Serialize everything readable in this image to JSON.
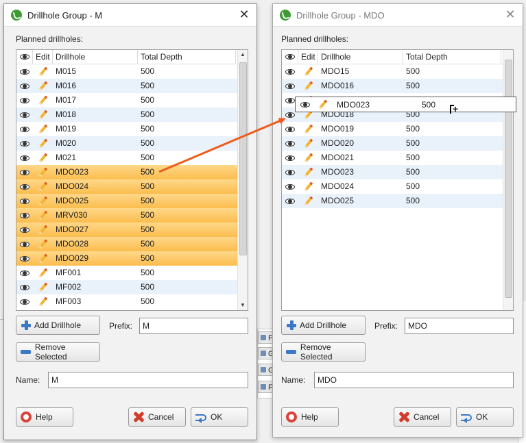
{
  "left_dialog": {
    "title": "Drillhole Group - M",
    "section_label": "Planned drillholes:",
    "columns": [
      "Edit",
      "Drillhole",
      "Total Depth"
    ],
    "rows": [
      {
        "name": "M015",
        "depth": "500",
        "selected": false
      },
      {
        "name": "M016",
        "depth": "500",
        "selected": false
      },
      {
        "name": "M017",
        "depth": "500",
        "selected": false
      },
      {
        "name": "M018",
        "depth": "500",
        "selected": false
      },
      {
        "name": "M019",
        "depth": "500",
        "selected": false
      },
      {
        "name": "M020",
        "depth": "500",
        "selected": false
      },
      {
        "name": "M021",
        "depth": "500",
        "selected": false
      },
      {
        "name": "MDO023",
        "depth": "500",
        "selected": true
      },
      {
        "name": "MDO024",
        "depth": "500",
        "selected": true
      },
      {
        "name": "MDO025",
        "depth": "500",
        "selected": true
      },
      {
        "name": "MRV030",
        "depth": "500",
        "selected": true
      },
      {
        "name": "MDO027",
        "depth": "500",
        "selected": true
      },
      {
        "name": "MDO028",
        "depth": "500",
        "selected": true
      },
      {
        "name": "MDO029",
        "depth": "500",
        "selected": true
      },
      {
        "name": "MF001",
        "depth": "500",
        "selected": false
      },
      {
        "name": "MF002",
        "depth": "500",
        "selected": false
      },
      {
        "name": "MF003",
        "depth": "500",
        "selected": false
      }
    ],
    "add_label": "Add Drillhole",
    "prefix_label": "Prefix:",
    "prefix_value": "M",
    "remove_label": "Remove Selected",
    "name_label": "Name:",
    "name_value": "M",
    "help_label": "Help",
    "cancel_label": "Cancel",
    "ok_label": "OK"
  },
  "right_dialog": {
    "title": "Drillhole Group - MDO",
    "section_label": "Planned drillholes:",
    "columns": [
      "Edit",
      "Drillhole",
      "Total Depth"
    ],
    "rows": [
      {
        "name": "MDO15",
        "depth": "500"
      },
      {
        "name": "MDO016",
        "depth": "500"
      },
      {
        "name": "",
        "depth": ""
      },
      {
        "name": "MDO018",
        "depth": "500"
      },
      {
        "name": "MDO019",
        "depth": "500"
      },
      {
        "name": "MDO020",
        "depth": "500"
      },
      {
        "name": "MDO021",
        "depth": "500"
      },
      {
        "name": "MDO023",
        "depth": "500"
      },
      {
        "name": "MDO024",
        "depth": "500"
      },
      {
        "name": "MDO025",
        "depth": "500"
      }
    ],
    "drag_ghost": {
      "name": "MDO023",
      "depth": "500"
    },
    "add_label": "Add Drillhole",
    "prefix_label": "Prefix:",
    "prefix_value": "MDO",
    "remove_label": "Remove Selected",
    "name_label": "Name:",
    "name_value": "MDO",
    "help_label": "Help",
    "cancel_label": "Cancel",
    "ok_label": "OK"
  },
  "background": {
    "buttons": [
      "Flat",
      "GM",
      "GM",
      "Flat"
    ]
  },
  "colors": {
    "selection": "#fbbd4e",
    "alt_row": "#e9f1fb",
    "arrow": "#f05a1a",
    "accent": "#3a78c8"
  }
}
